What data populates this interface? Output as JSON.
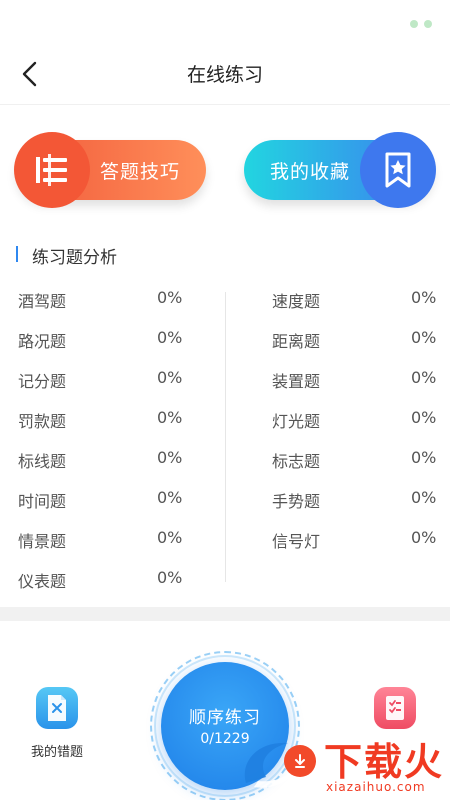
{
  "header": {
    "title": "在线练习"
  },
  "features": {
    "tips_label": "答题技巧",
    "favorites_label": "我的收藏"
  },
  "analysis": {
    "title": "练习题分析",
    "left": [
      {
        "name": "酒驾题",
        "value": "0%"
      },
      {
        "name": "路况题",
        "value": "0%"
      },
      {
        "name": "记分题",
        "value": "0%"
      },
      {
        "name": "罚款题",
        "value": "0%"
      },
      {
        "name": "标线题",
        "value": "0%"
      },
      {
        "name": "时间题",
        "value": "0%"
      },
      {
        "name": "情景题",
        "value": "0%"
      },
      {
        "name": "仪表题",
        "value": "0%"
      }
    ],
    "right": [
      {
        "name": "速度题",
        "value": "0%"
      },
      {
        "name": "距离题",
        "value": "0%"
      },
      {
        "name": "装置题",
        "value": "0%"
      },
      {
        "name": "灯光题",
        "value": "0%"
      },
      {
        "name": "标志题",
        "value": "0%"
      },
      {
        "name": "手势题",
        "value": "0%"
      },
      {
        "name": "信号灯",
        "value": "0%"
      }
    ]
  },
  "bottom": {
    "wrong_label": "我的错题",
    "sequential_title": "顺序练习",
    "sequential_count": "0/1229"
  },
  "watermark": {
    "brand": "下载火",
    "url": "xiazaihuo.com"
  },
  "colors": {
    "tips_gradient": [
      "#f15a3a",
      "#ff8f5a"
    ],
    "favorites_gradient": [
      "#22d5e0",
      "#3d7cf0"
    ],
    "accent_blue": "#2f88f0",
    "watermark_red": "#f03a22"
  },
  "icons": {
    "back": "chevron-left-icon",
    "tips": "list-icon",
    "favorites": "bookmark-star-icon",
    "wrong": "document-x-icon",
    "note": "checklist-icon",
    "watermark": "download-icon"
  }
}
